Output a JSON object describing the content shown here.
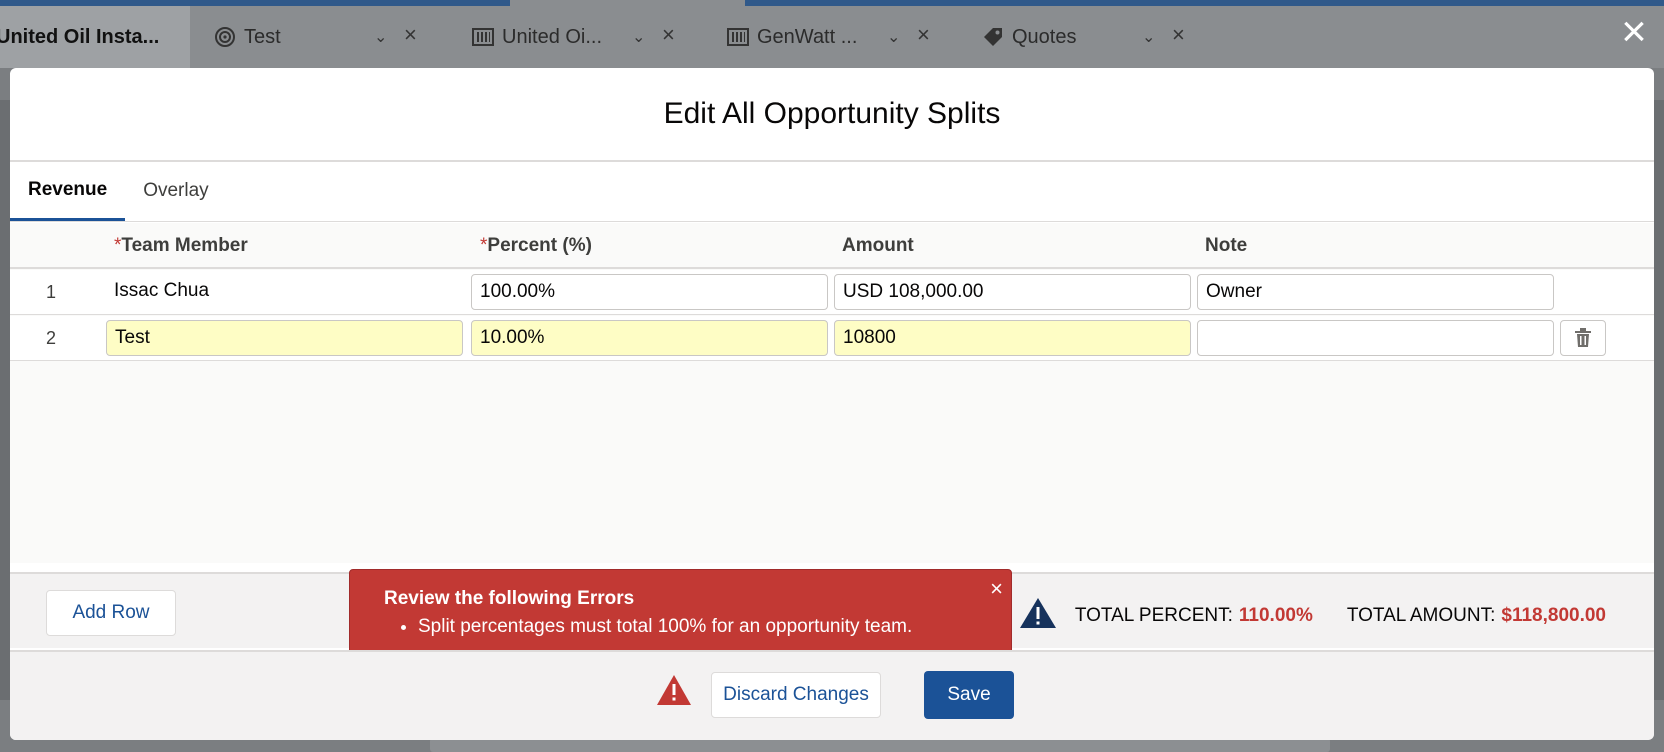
{
  "tabs": [
    {
      "label": "United Oil Insta...",
      "icon": "record-icon"
    },
    {
      "label": "Test",
      "icon": "target-icon"
    },
    {
      "label": "United Oi...",
      "icon": "barcode-icon"
    },
    {
      "label": "GenWatt ...",
      "icon": "barcode-icon"
    },
    {
      "label": "Quotes",
      "icon": "tag-icon"
    }
  ],
  "modal": {
    "title": "Edit All Opportunity Splits",
    "tabs": [
      "Revenue",
      "Overlay"
    ],
    "active_tab": "Revenue",
    "columns": {
      "required_marker": "*",
      "team_member": "Team Member",
      "percent": "Percent (%)",
      "amount": "Amount",
      "note": "Note"
    },
    "rows": [
      {
        "num": "1",
        "member": "Issac Chua",
        "percent": "100.00%",
        "amount": "USD 108,000.00",
        "note": "Owner"
      },
      {
        "num": "2",
        "member": "Test",
        "percent": "10.00%",
        "amount": "10800",
        "note": ""
      }
    ],
    "add_row": "Add Row",
    "totals": {
      "percent_label": "TOTAL PERCENT:",
      "percent_value": "110.00%",
      "amount_label": "TOTAL AMOUNT:",
      "amount_value": "$118,800.00"
    },
    "error": {
      "title": "Review the following Errors",
      "items": [
        "Split percentages must total 100% for an opportunity team."
      ]
    },
    "buttons": {
      "discard": "Discard Changes",
      "save": "Save"
    }
  },
  "colors": {
    "accent": "#1b5297",
    "error": "#c23934",
    "highlight": "#fefdc5"
  }
}
